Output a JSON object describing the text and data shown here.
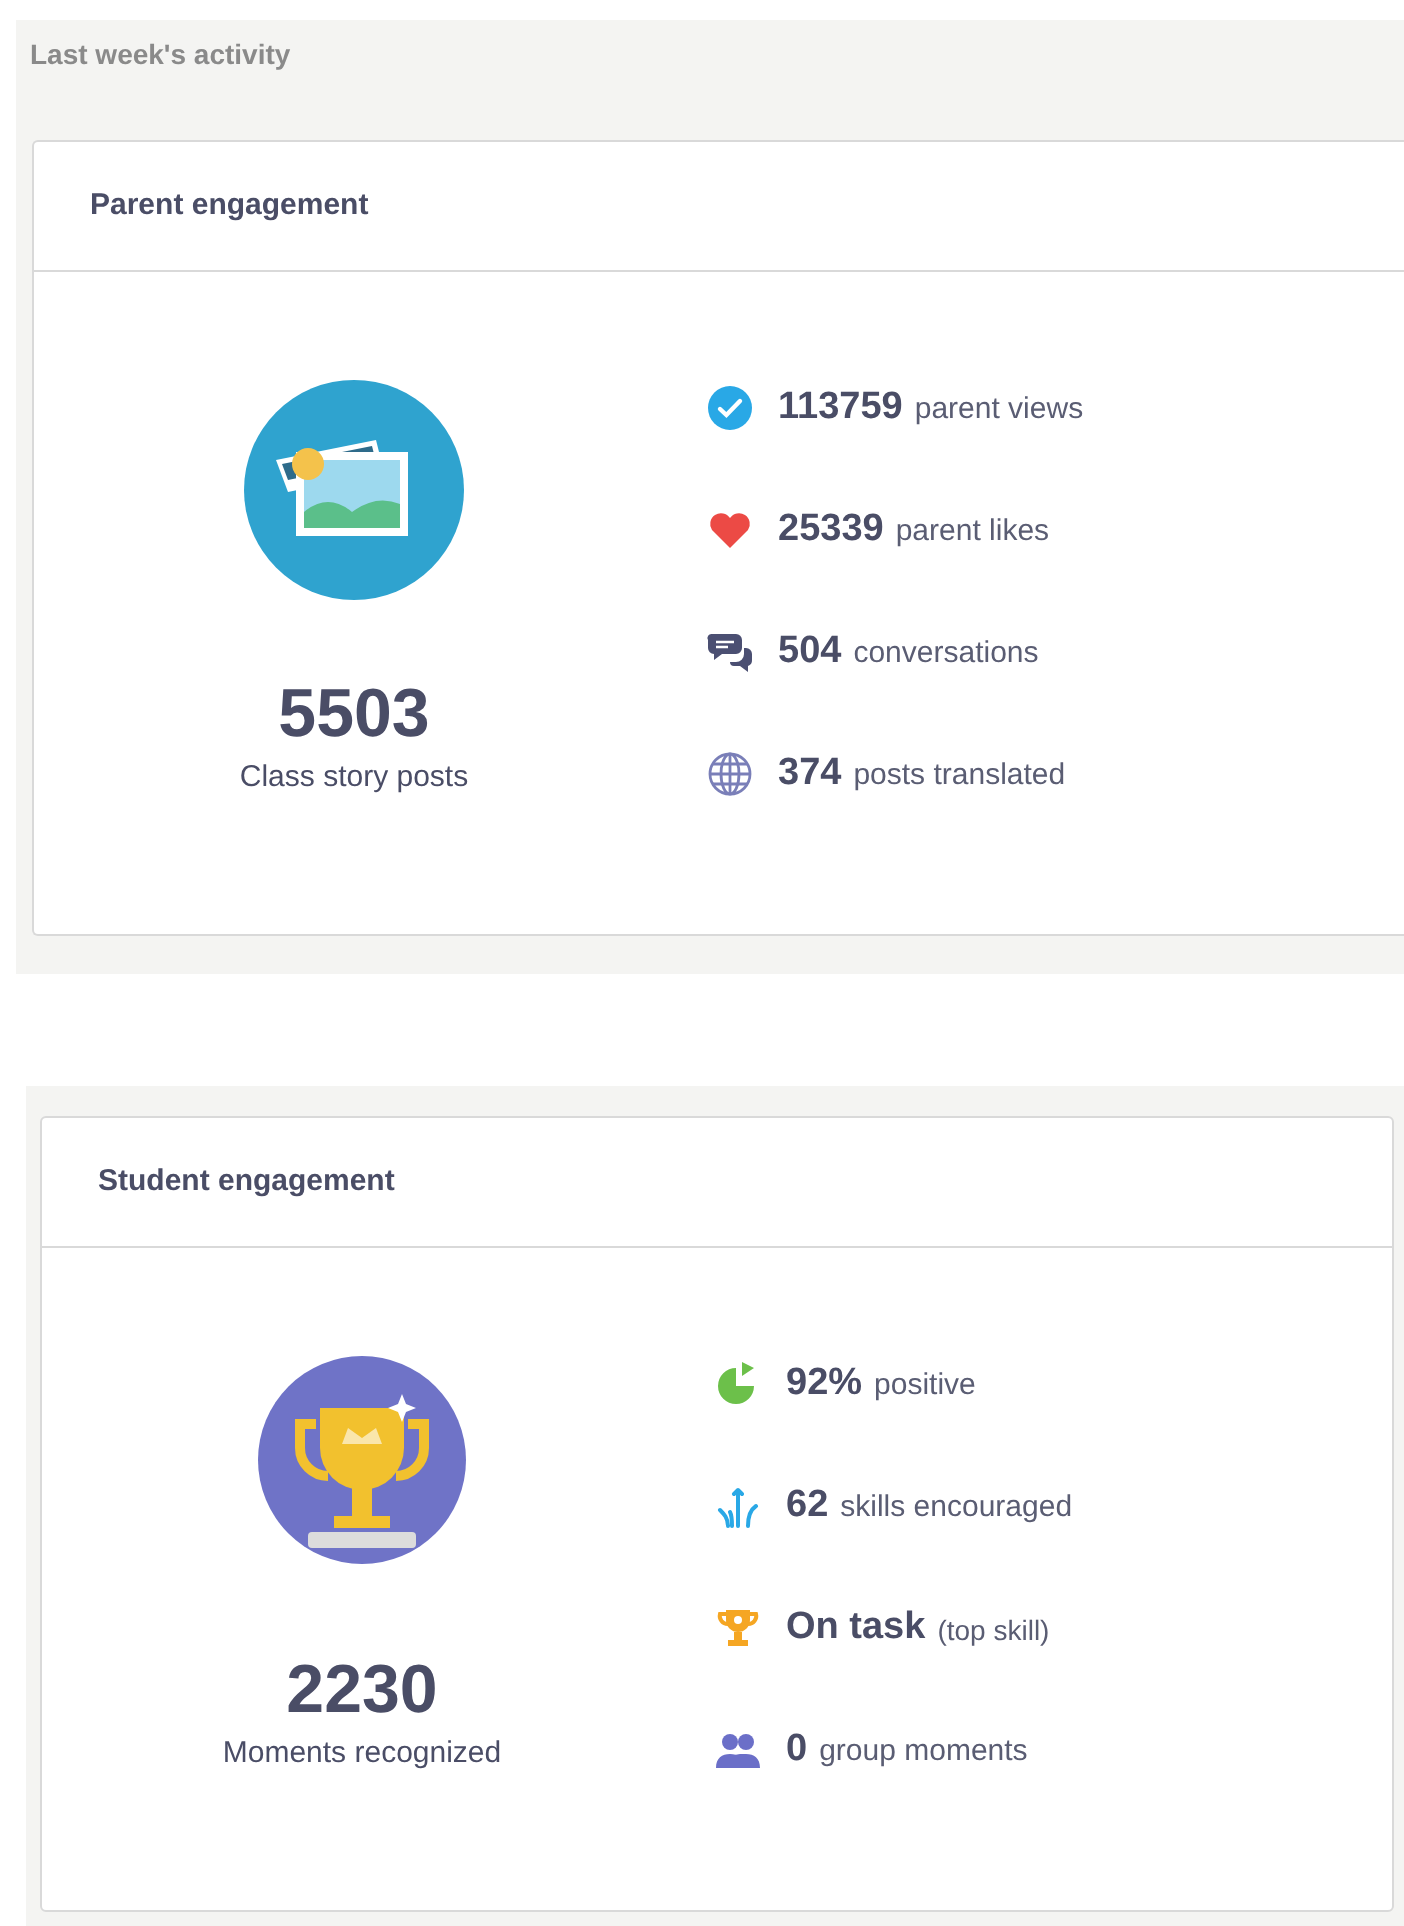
{
  "section_title": "Last week's activity",
  "cards": [
    {
      "title": "Parent engagement",
      "hero": {
        "kind": "photos",
        "number": "5503",
        "label": "Class story posts"
      },
      "stats": [
        {
          "kind": "check",
          "value": "113759",
          "label": "parent views"
        },
        {
          "kind": "heart",
          "value": "25339",
          "label": "parent likes"
        },
        {
          "kind": "chat",
          "value": "504",
          "label": "conversations"
        },
        {
          "kind": "globe",
          "value": "374",
          "label": "posts translated"
        }
      ]
    },
    {
      "title": "Student engagement",
      "hero": {
        "kind": "trophy",
        "number": "2230",
        "label": "Moments recognized"
      },
      "stats": [
        {
          "kind": "pie",
          "value": "92%",
          "label": "positive"
        },
        {
          "kind": "skills",
          "value": "62",
          "label": "skills encouraged"
        },
        {
          "kind": "cup",
          "value": "On task",
          "label": "(top skill)"
        },
        {
          "kind": "group",
          "value": "0",
          "label": "group moments"
        }
      ]
    }
  ]
}
